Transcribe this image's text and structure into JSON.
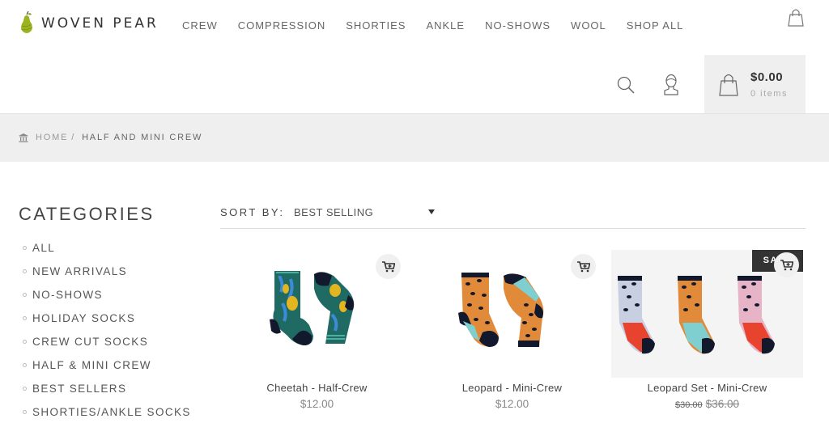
{
  "brand": {
    "name": "WOVEN PEAR"
  },
  "nav": {
    "items": [
      "CREW",
      "COMPRESSION",
      "SHORTIES",
      "ANKLE",
      "NO-SHOWS",
      "WOOL",
      "SHOP ALL"
    ]
  },
  "cart": {
    "total": "$0.00",
    "items": "0 items"
  },
  "breadcrumb": {
    "home": "HOME",
    "separator": "/",
    "current": "HALF AND MINI CREW"
  },
  "sidebar": {
    "title": "CATEGORIES",
    "items": [
      "ALL",
      "NEW ARRIVALS",
      "NO-SHOWS",
      "HOLIDAY SOCKS",
      "CREW CUT SOCKS",
      "HALF & MINI CREW",
      "BEST SELLERS",
      "SHORTIES/ANKLE SOCKS"
    ]
  },
  "sort": {
    "label": "SORT BY:",
    "value": "BEST SELLING"
  },
  "products": [
    {
      "name": "Cheetah - Half-Crew",
      "price": "$12.00"
    },
    {
      "name": "Leopard - Mini-Crew",
      "price": "$12.00"
    },
    {
      "name": "Leopard Set - Mini-Crew",
      "price_original": "$30.00",
      "price": "$36.00",
      "badge": "SALE"
    }
  ],
  "colors": {
    "accent_pear": "#9bb31f",
    "navy": "#1b2340",
    "teal": "#1f6b63",
    "aqua": "#7fcfd0",
    "orange": "#e08a3a",
    "red": "#e8432e"
  },
  "icons": [
    "pear-logo-icon",
    "shopping-bag-icon",
    "search-icon",
    "account-icon",
    "cart-add-icon",
    "home-icon"
  ]
}
